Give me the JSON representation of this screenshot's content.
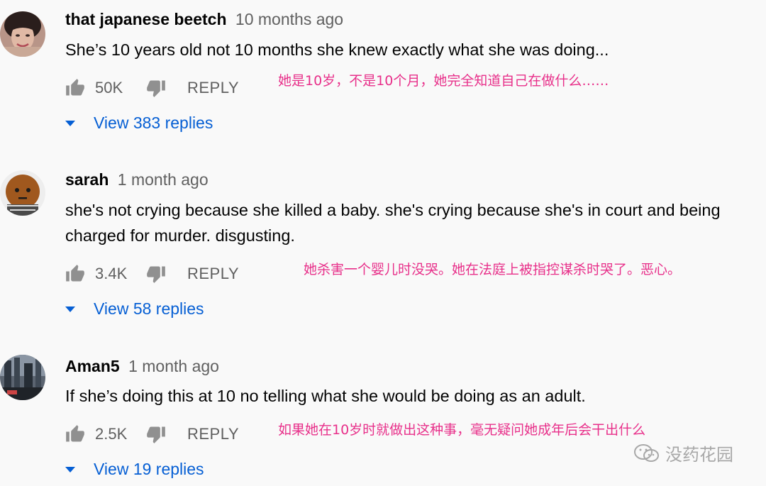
{
  "comments": [
    {
      "author": "that japanese beetch",
      "time": "10 months ago",
      "text": "She’s 10 years old not 10 months she knew exactly what she was doing...",
      "likes": "50K",
      "reply_label": "REPLY",
      "translation": "她是10岁，不是10个月，她完全知道自己在做什么……",
      "view_replies": "View 383 replies"
    },
    {
      "author": "sarah",
      "time": "1 month ago",
      "text": "she's not crying because she killed a baby. she's crying because she's in court and being charged for murder. disgusting.",
      "likes": "3.4K",
      "reply_label": "REPLY",
      "translation": "她杀害一个婴儿时没哭。她在法庭上被指控谋杀时哭了。恶心。",
      "view_replies": "View 58 replies"
    },
    {
      "author": "Aman5",
      "time": "1 month ago",
      "text": "If she’s doing this at 10 no telling what she would be doing as an adult.",
      "likes": "2.5K",
      "reply_label": "REPLY",
      "translation": "如果她在10岁时就做出这种事，毫无疑问她成年后会干出什么",
      "view_replies": "View 19 replies"
    }
  ],
  "watermark": {
    "text": "没药花园",
    "icon": "wechat-icon"
  },
  "colors": {
    "link": "#065fd4",
    "translation": "#e8308a",
    "secondary": "#606060"
  }
}
